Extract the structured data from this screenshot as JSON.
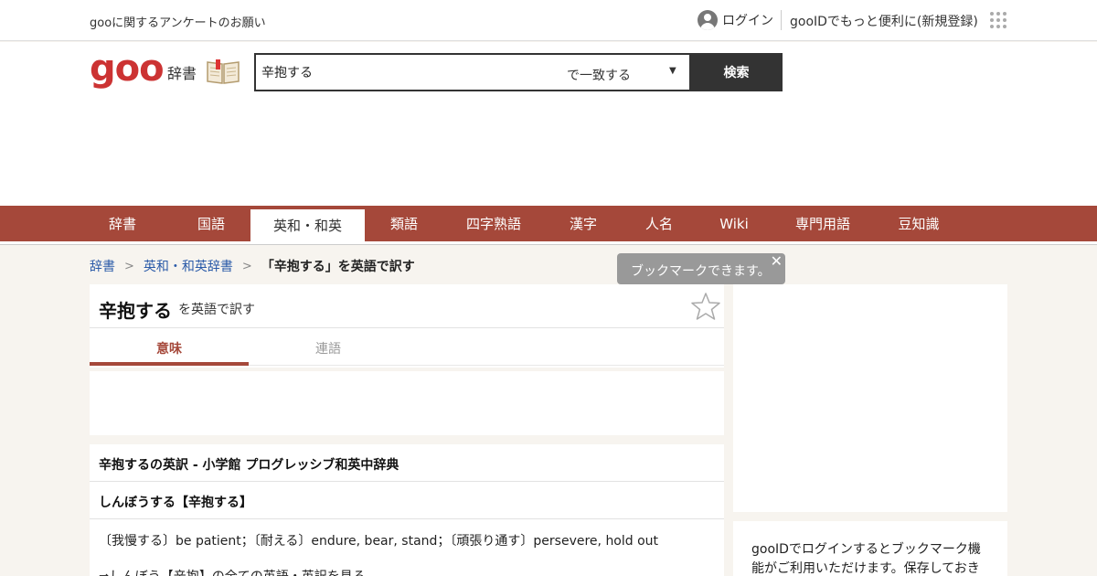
{
  "topbar": {
    "survey": "gooに関するアンケートのお願い",
    "login": "ログイン",
    "register": "gooIDでもっと便利に(新規登録)"
  },
  "header": {
    "logo": "goo",
    "section": "辞書",
    "search_value": "辛抱する",
    "search_mode": "で一致する",
    "search_button": "検索"
  },
  "nav": {
    "items": [
      "辞書",
      "国語",
      "英和・和英",
      "類語",
      "四字熟語",
      "漢字",
      "人名",
      "Wiki",
      "専門用語",
      "豆知識"
    ],
    "active_index": 2
  },
  "breadcrumb": {
    "items": [
      "辞書",
      "英和・和英辞書"
    ],
    "current": "「辛抱する」を英語で訳す"
  },
  "tooltip": {
    "text": "ブックマークできます。",
    "close": "✕"
  },
  "entry": {
    "word": "辛抱する",
    "subtitle": "を英語で訳す",
    "tabs": [
      "意味",
      "連語"
    ]
  },
  "result": {
    "source_heading": "辛抱するの英訳 - 小学館 プログレッシブ和英中辞典",
    "headword": "しんぼうする【辛抱する】",
    "definition": "〔我慢する〕be patient；〔耐える〕endure, bear, stand；〔頑張り通す〕persevere, hold out",
    "see_more": "⇒しんぼう【辛抱】の全ての英語・英訳を見る"
  },
  "sidebar": {
    "info": "gooIDでログインするとブックマーク機能がご利用いただけます。保存しておき"
  },
  "colors": {
    "brand": "#a5483a",
    "logo": "#cc3333",
    "link": "#2a5aa8"
  }
}
